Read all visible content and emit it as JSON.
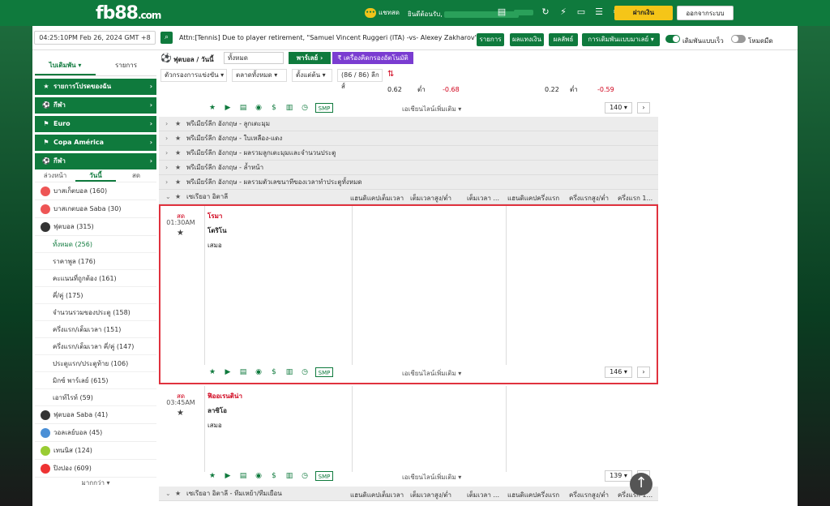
{
  "brand": {
    "logo": "fb88",
    "logo_suffix": ".com"
  },
  "topbar": {
    "chat_label": "แชทสด",
    "welcome": "ยินดีต้อนรับ,",
    "deposit": "ฝากเงิน",
    "logout": "ออกจากระบบ"
  },
  "infobar": {
    "datetime": "04:25:10PM Feb 26, 2024 GMT +8",
    "news": "Attn:[Tennis] Due to player retirement, \"Samuel Vincent Ruggeri (ITA) -vs- Alexey Zakharov\"",
    "btn_list": "รายการ",
    "btn_result": "ผลแทงเงิน",
    "btn_result2": "ผลลัพธ์",
    "btn_odds": "การเดิมพันแบบมาเลย์ ▾",
    "quick_bet": "เดิมพันแบบเร็ว",
    "dark_mode": "โหมดมืด"
  },
  "sidebar": {
    "tab_active": "ไบเดิมพัน ▾",
    "tab_list": "รายการ",
    "heads": [
      {
        "label": "รายการโปรดของฉัน",
        "icon": "★"
      },
      {
        "label": "กีฬา",
        "icon": "⚽"
      },
      {
        "label": "Euro",
        "icon": "⚑"
      },
      {
        "label": "Copa América",
        "icon": "⚑"
      },
      {
        "label": "กีฬา",
        "icon": "⚽"
      }
    ],
    "subtabs": {
      "a": "ล่วงหน้า",
      "b": "วันนี้",
      "c": "สด"
    },
    "items": [
      {
        "label": "บาสเก็ตบอล (160)",
        "color": "#e55"
      },
      {
        "label": "บาสเกตบอล Saba (30)",
        "color": "#e55"
      },
      {
        "label": "ฟุตบอล (315)",
        "color": "#333"
      }
    ],
    "subitems": [
      "ทั้งหมด (256)",
      "ราคาพูล (176)",
      "คะแนนที่ถูกต้อง (161)",
      "คี่/คู่ (175)",
      "จำนวนรวมของประตู (158)",
      "ครึ่งแรก/เต็มเวลา (151)",
      "ครึ่งแรก/เต็มเวลา คี่/คู่ (147)",
      "ประตูแรก/ประตูท้าย (106)",
      "มิกซ์ พาร์เลย์ (615)",
      "เอาท์ไรท์ (59)"
    ],
    "items2": [
      {
        "label": "ฟุตบอล Saba (41)",
        "color": "#333"
      },
      {
        "label": "วอลเลย์บอล (45)",
        "color": "#4a8fd6"
      },
      {
        "label": "เทนนิส (124)",
        "color": "#9c3"
      },
      {
        "label": "ปิงปอง (609)",
        "color": "#e33"
      }
    ],
    "more": "มากกว่า ▾"
  },
  "content": {
    "title": "ฟุตบอล / วันนี้",
    "filter_all": "ทั้งหมด",
    "parlay": "พาร์เลย์ ›",
    "calc": "₹ เครื่องคิดกรองอัตโนมัติ",
    "filters": [
      "ตัวกรองการแข่งขัน ▾",
      "ตลาดทั้งหมด ▾",
      "ตั้งแต่ต้น ▾",
      "(86 / 86) ลีกส์"
    ],
    "more_markets": "เอเชียนไลน์เพิ่มเติม ▾",
    "smp": "SMP",
    "pager1": "140 ▾",
    "pager2": "146 ▾",
    "pager3": "139 ▾",
    "leagues": [
      "พรีเมียร์ลีก อังกฤษ - ลูกเตะมุม",
      "พรีเมียร์ลีก อังกฤษ - ใบเหลือง-แดง",
      "พรีเมียร์ลีก อังกฤษ - ผลรวมลูกเตะมุมและจำนวนประตู",
      "พรีเมียร์ลีก อังกฤษ - ล้ำหน้า",
      "พรีเมียร์ลีก อังกฤษ - ผลรวมตัวเลขนาทีของเวลาทำประตูทั้งหมด"
    ],
    "serie_a": "เซเรียอา อิตาลี",
    "serie_a2": "เซเรียอา อิตาลี - ทีมเหย้า/ทีมเยือน",
    "headers": [
      "แฮนดิแคปเต็มเวลา",
      "เต็มเวลาสูง/ต่ำ",
      "เต็มเวลา ...",
      "แฮนดิแคปครึ่งแรก",
      "ครึ่งแรกสูง/ต่ำ",
      "ครึ่งแรก 1..."
    ],
    "top_row": {
      "a": "0.62",
      "b": "ต่ำ",
      "c": "-0.68",
      "d": "0.22",
      "e": "ต่ำ",
      "f": "-0.59"
    },
    "match1": {
      "live": "สด",
      "time": "01:30AM",
      "home": "โรมา",
      "away": "โตริโน",
      "draw": "เสมอ"
    },
    "match2": {
      "live": "สด",
      "time": "03:45AM",
      "home": "ฟิออเรนติน่า",
      "away": "ลาซิโอ",
      "draw": "เสมอ"
    }
  },
  "colors": {
    "brand": "#0f7a3d",
    "negative": "#d0021b",
    "highlight": "#e0323e",
    "purple": "#7a3cd1",
    "deposit": "#f5c518"
  }
}
